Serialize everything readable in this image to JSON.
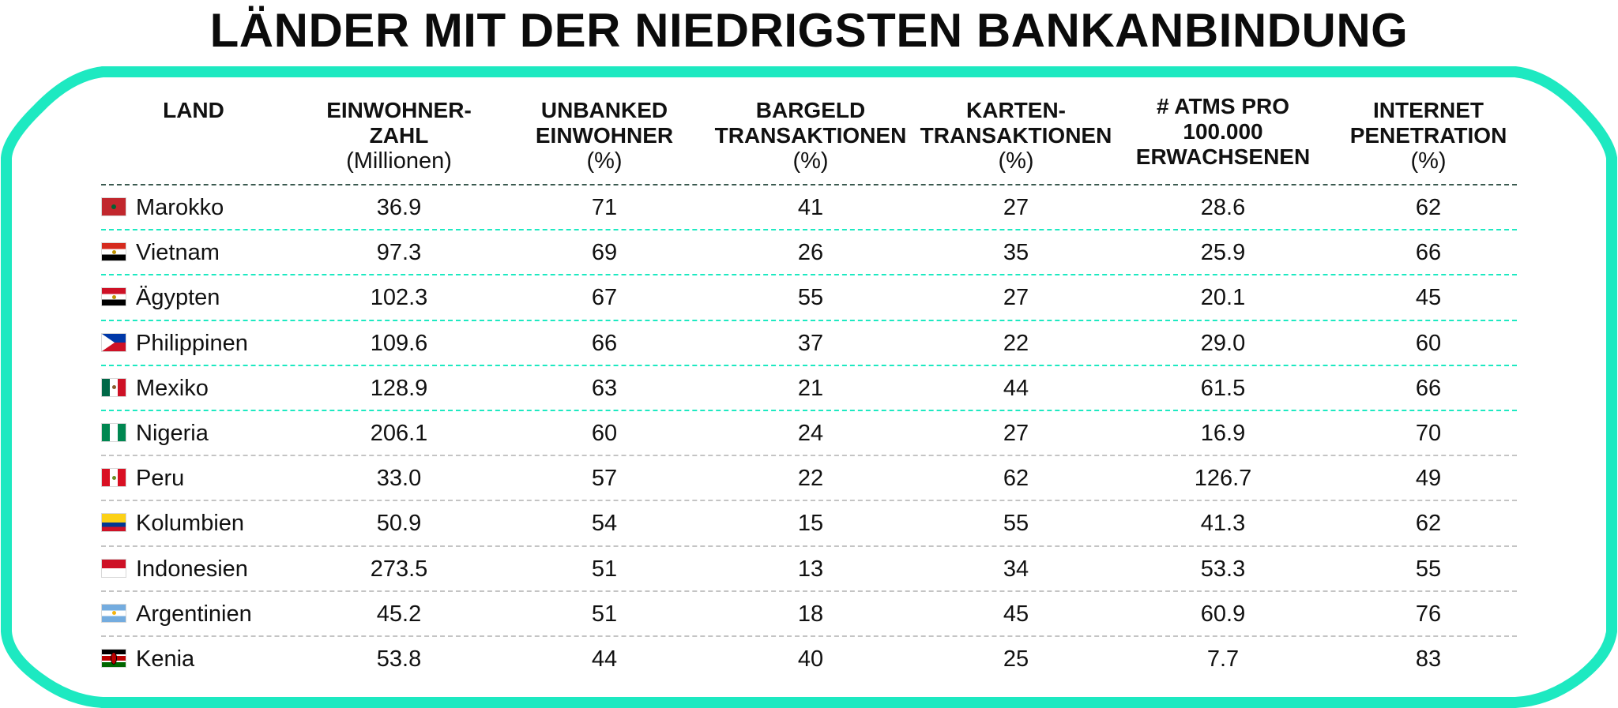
{
  "title": "LÄNDER MIT DER NIEDRIGSTEN BANKANBINDUNG",
  "colors": {
    "accent": "#1de9c1",
    "divider_top": "#3b5a50",
    "divider_gray": "#c4c4c4",
    "text": "#111111"
  },
  "chart_data": {
    "type": "table",
    "title": "LÄNDER MIT DER NIEDRIGSTEN BANKANBINDUNG",
    "columns": [
      {
        "lines": [
          "LAND"
        ],
        "sub": ""
      },
      {
        "lines": [
          "EINWOHNER-",
          "ZAHL"
        ],
        "sub": "(Millionen)"
      },
      {
        "lines": [
          "UNBANKED",
          "EINWOHNER"
        ],
        "sub": "(%)"
      },
      {
        "lines": [
          "BARGELD",
          "TRANSAKTIONEN"
        ],
        "sub": "(%)"
      },
      {
        "lines": [
          "KARTEN-",
          "TRANSAKTIONEN"
        ],
        "sub": "(%)"
      },
      {
        "lines": [
          "# ATMS PRO",
          "100.000",
          "ERWACHSENEN"
        ],
        "sub": ""
      },
      {
        "lines": [
          "INTERNET",
          "PENETRATION"
        ],
        "sub": "(%)"
      }
    ],
    "rows": [
      {
        "country": "Marokko",
        "flag": "morocco-flag-icon",
        "values": [
          "36.9",
          "71",
          "41",
          "27",
          "28.6",
          "62"
        ]
      },
      {
        "country": "Vietnam",
        "flag": "vietnam-flag-icon",
        "values": [
          "97.3",
          "69",
          "26",
          "35",
          "25.9",
          "66"
        ]
      },
      {
        "country": "Ägypten",
        "flag": "egypt-flag-icon",
        "values": [
          "102.3",
          "67",
          "55",
          "27",
          "20.1",
          "45"
        ]
      },
      {
        "country": "Philippinen",
        "flag": "philippines-flag-icon",
        "values": [
          "109.6",
          "66",
          "37",
          "22",
          "29.0",
          "60"
        ]
      },
      {
        "country": "Mexiko",
        "flag": "mexico-flag-icon",
        "values": [
          "128.9",
          "63",
          "21",
          "44",
          "61.5",
          "66"
        ]
      },
      {
        "country": "Nigeria",
        "flag": "nigeria-flag-icon",
        "values": [
          "206.1",
          "60",
          "24",
          "27",
          "16.9",
          "70"
        ]
      },
      {
        "country": "Peru",
        "flag": "peru-flag-icon",
        "values": [
          "33.0",
          "57",
          "22",
          "62",
          "126.7",
          "49"
        ]
      },
      {
        "country": "Kolumbien",
        "flag": "colombia-flag-icon",
        "values": [
          "50.9",
          "54",
          "15",
          "55",
          "41.3",
          "62"
        ]
      },
      {
        "country": "Indonesien",
        "flag": "indonesia-flag-icon",
        "values": [
          "273.5",
          "51",
          "13",
          "34",
          "53.3",
          "55"
        ]
      },
      {
        "country": "Argentinien",
        "flag": "argentina-flag-icon",
        "values": [
          "45.2",
          "51",
          "18",
          "45",
          "60.9",
          "76"
        ]
      },
      {
        "country": "Kenia",
        "flag": "kenya-flag-icon",
        "values": [
          "53.8",
          "44",
          "40",
          "25",
          "7.7",
          "83"
        ]
      }
    ]
  }
}
